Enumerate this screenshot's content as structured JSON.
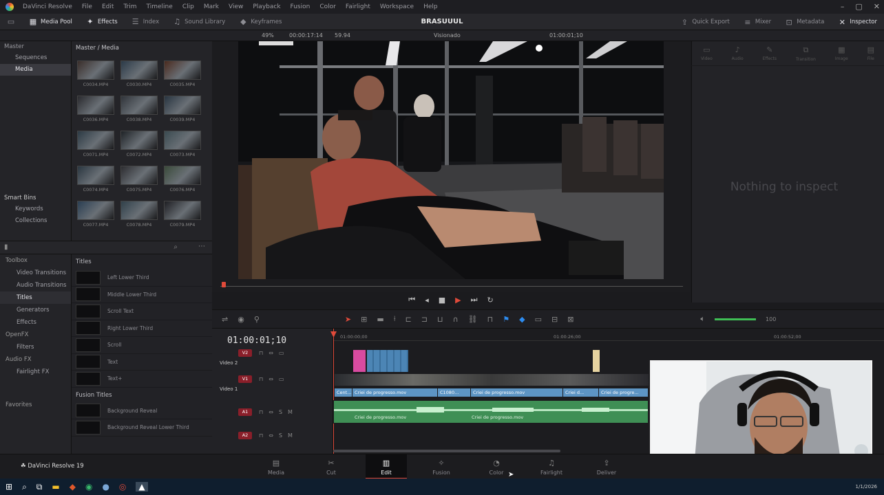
{
  "menubar": {
    "app_name": "DaVinci Resolve",
    "items": [
      "File",
      "Edit",
      "Trim",
      "Timeline",
      "Clip",
      "Mark",
      "View",
      "Playback",
      "Fusion",
      "Color",
      "Fairlight",
      "Workspace",
      "Help"
    ]
  },
  "toolbar": {
    "left": [
      "Media Pool",
      "Effects",
      "Index",
      "Sound Library",
      "Keyframes"
    ],
    "project_title": "BRASUUUL",
    "right": [
      "Quick Export",
      "Mixer",
      "Metadata",
      "Inspector"
    ]
  },
  "subbar": {
    "zoom": "49%",
    "timecode_left": "00:00:17:14",
    "fps": "59.94",
    "viewer_label": "Visionado",
    "timecode_right": "01:00:01;10"
  },
  "bins": {
    "master": "Master",
    "items": [
      "Sequences",
      "Media"
    ],
    "smart_bins": "Smart Bins",
    "smart_items": [
      "Keywords",
      "Collections"
    ]
  },
  "media": {
    "title": "Master / Media",
    "clips": [
      "C0034.MP4",
      "C0030.MP4",
      "C0035.MP4",
      "C0036.MP4",
      "C0038.MP4",
      "C0039.MP4",
      "C0071.MP4",
      "C0072.MP4",
      "C0073.MP4",
      "C0074.MP4",
      "C0075.MP4",
      "C0076.MP4",
      "C0077.MP4",
      "C0078.MP4",
      "C0079.MP4"
    ]
  },
  "toolbox": {
    "head": "Toolbox",
    "items": [
      "Video Transitions",
      "Audio Transitions",
      "Titles",
      "Generators",
      "Effects"
    ],
    "openfx": "OpenFX",
    "openfx_items": [
      "Filters"
    ],
    "audiofx": "Audio FX",
    "audiofx_items": [
      "Fairlight FX"
    ],
    "favorites": "Favorites"
  },
  "titles": {
    "head": "Titles",
    "items": [
      "Left Lower Third",
      "Middle Lower Third",
      "Scroll Text",
      "Right Lower Third",
      "Scroll",
      "Text",
      "Text+"
    ],
    "fusion_head": "Fusion Titles",
    "fusion_items": [
      "Background Reveal",
      "Background Reveal Lower Third"
    ]
  },
  "inspector": {
    "tabs": [
      "Video",
      "Audio",
      "Effects",
      "Transition",
      "Image",
      "File"
    ],
    "empty": "Nothing to inspect"
  },
  "timeline": {
    "timecode": "01:00:01;10",
    "ruler": [
      "01:00:00;00",
      "01:00:26;00",
      "01:00:52;00"
    ],
    "tracks": [
      {
        "badge": "V2",
        "name": "Video 2"
      },
      {
        "badge": "V1",
        "name": "Video 1"
      },
      {
        "badge": "A1",
        "name": ""
      },
      {
        "badge": "A2",
        "name": ""
      }
    ],
    "clips": [
      "Cent...",
      "Criei de progresso.mov",
      "C1080...",
      "Criei de progresso.mov",
      "Criei d...",
      "Criei de progre..."
    ],
    "volume": "100"
  },
  "pages": [
    "Media",
    "Cut",
    "Edit",
    "Fusion",
    "Color",
    "Fairlight",
    "Deliver"
  ],
  "active_page": "Edit",
  "footer_app": "DaVinci Resolve 19",
  "clock": "1/1/2026"
}
